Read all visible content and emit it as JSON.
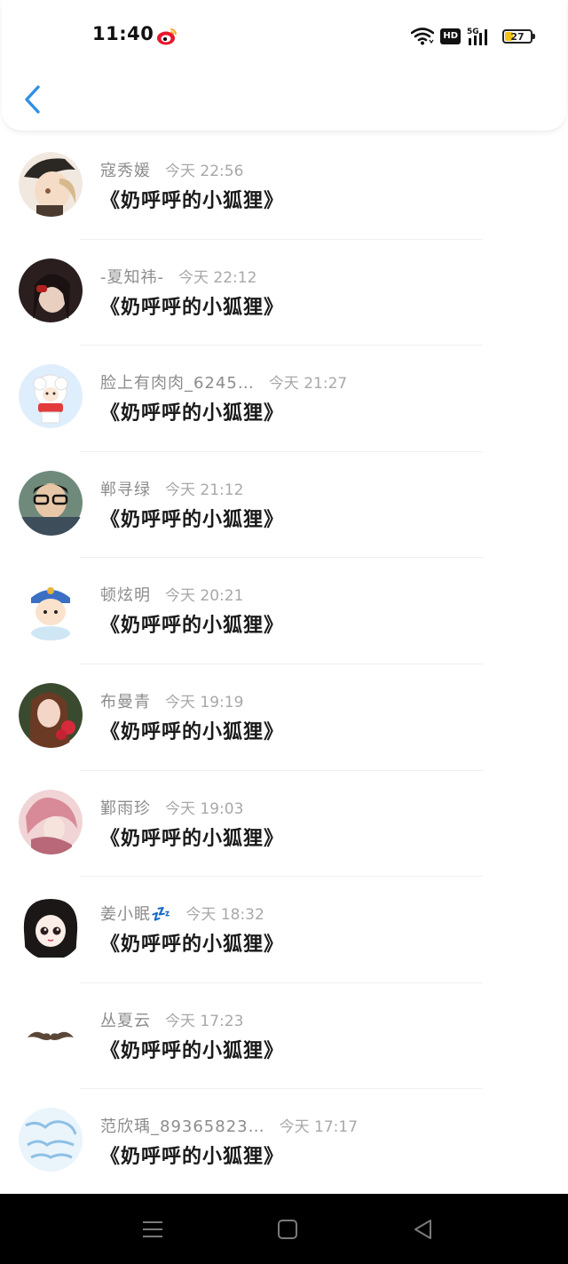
{
  "status_bar": {
    "time": "11:40",
    "network": "5G",
    "hd_label": "HD",
    "battery_level": "27"
  },
  "list": {
    "items": [
      {
        "name": "寇秀媛",
        "time": "今天 22:56",
        "message": "《奶呼呼的小狐狸》"
      },
      {
        "name": "-夏知祎-",
        "time": "今天 22:12",
        "message": "《奶呼呼的小狐狸》"
      },
      {
        "name": "脸上有肉肉_6245…",
        "time": "今天 21:27",
        "message": "《奶呼呼的小狐狸》"
      },
      {
        "name": "郸寻绿",
        "time": "今天 21:12",
        "message": "《奶呼呼的小狐狸》"
      },
      {
        "name": "顿炫明",
        "time": "今天 20:21",
        "message": "《奶呼呼的小狐狸》"
      },
      {
        "name": "布曼青",
        "time": "今天 19:19",
        "message": "《奶呼呼的小狐狸》"
      },
      {
        "name": "鄞雨珍",
        "time": "今天 19:03",
        "message": "《奶呼呼的小狐狸》"
      },
      {
        "name": "姜小眠💤",
        "time": "今天 18:32",
        "message": "《奶呼呼的小狐狸》"
      },
      {
        "name": "丛夏云",
        "time": "今天 17:23",
        "message": "《奶呼呼的小狐狸》"
      },
      {
        "name": "范欣瑀_89365823…",
        "time": "今天 17:17",
        "message": "《奶呼呼的小狐狸》"
      }
    ]
  },
  "colors": {
    "accent": "#2f8fe6",
    "name_gray": "#8c8c8c",
    "message_black": "#1a1a1a",
    "navbar_bg": "#000000"
  }
}
